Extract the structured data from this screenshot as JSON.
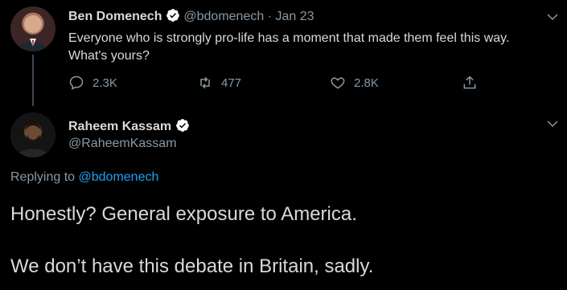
{
  "tweet1": {
    "author_name": "Ben Domenech",
    "author_handle": "@bdomenech",
    "separator": "·",
    "date": "Jan 23",
    "text": "Everyone who is strongly pro-life has a moment that made them feel this way. What's yours?",
    "actions": {
      "reply_count": "2.3K",
      "retweet_count": "477",
      "like_count": "2.8K"
    }
  },
  "tweet2": {
    "author_name": "Raheem Kassam",
    "author_handle": "@RaheemKassam",
    "replying_prefix": "Replying to",
    "replying_handle": "@bdomenech",
    "text_line1": "Honestly? General exposure to America.",
    "text_line2": "We don’t have this debate in Britain, sadly."
  },
  "colors": {
    "background": "#000000",
    "text": "#d9d9d9",
    "muted": "#8899a6",
    "link": "#1da1f2",
    "verified": "#ffffff"
  },
  "icons": [
    "chevron-down-icon",
    "verified-badge-icon",
    "reply-icon",
    "retweet-icon",
    "like-icon",
    "share-icon"
  ]
}
